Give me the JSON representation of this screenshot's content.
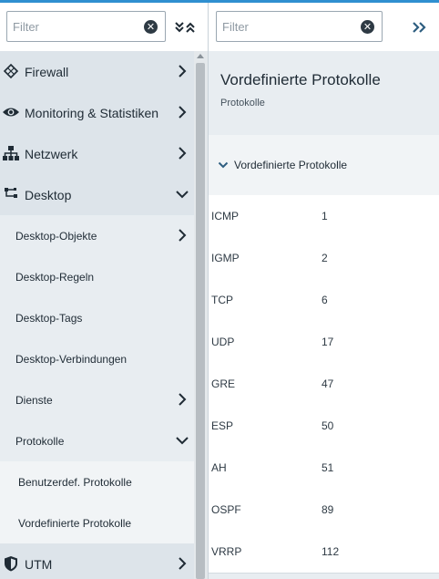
{
  "left_panel": {
    "filter_placeholder": "Filter",
    "nav": [
      {
        "label": "Firewall",
        "icon": "firewall-icon"
      },
      {
        "label": "Monitoring & Statistiken",
        "icon": "eye-icon"
      },
      {
        "label": "Netzwerk",
        "icon": "network-icon"
      },
      {
        "label": "Desktop",
        "icon": "desktop-icon"
      },
      {
        "label": "Desktop-Objekte"
      },
      {
        "label": "Desktop-Regeln"
      },
      {
        "label": "Desktop-Tags"
      },
      {
        "label": "Desktop-Verbindungen"
      },
      {
        "label": "Dienste"
      },
      {
        "label": "Protokolle"
      },
      {
        "label": "Benutzerdef. Protokolle"
      },
      {
        "label": "Vordefinierte Protokolle"
      },
      {
        "label": "UTM",
        "icon": "shield-icon"
      }
    ]
  },
  "right_panel": {
    "filter_placeholder": "Filter",
    "title": "Vordefinierte Protokolle",
    "subtitle": "Protokolle",
    "section_label": "Vordefinierte Protokolle",
    "rows": [
      {
        "name": "ICMP",
        "number": "1"
      },
      {
        "name": "IGMP",
        "number": "2"
      },
      {
        "name": "TCP",
        "number": "6"
      },
      {
        "name": "UDP",
        "number": "17"
      },
      {
        "name": "GRE",
        "number": "47"
      },
      {
        "name": "ESP",
        "number": "50"
      },
      {
        "name": "AH",
        "number": "51"
      },
      {
        "name": "OSPF",
        "number": "89"
      },
      {
        "name": "VRRP",
        "number": "112"
      }
    ]
  },
  "colors": {
    "accent": "#2f8fd0",
    "nav_top_bg": "#dde4ea",
    "nav_sub_bg": "#e8edf1",
    "nav_subsub_bg": "#f1f4f6",
    "text": "#1f2b35"
  }
}
